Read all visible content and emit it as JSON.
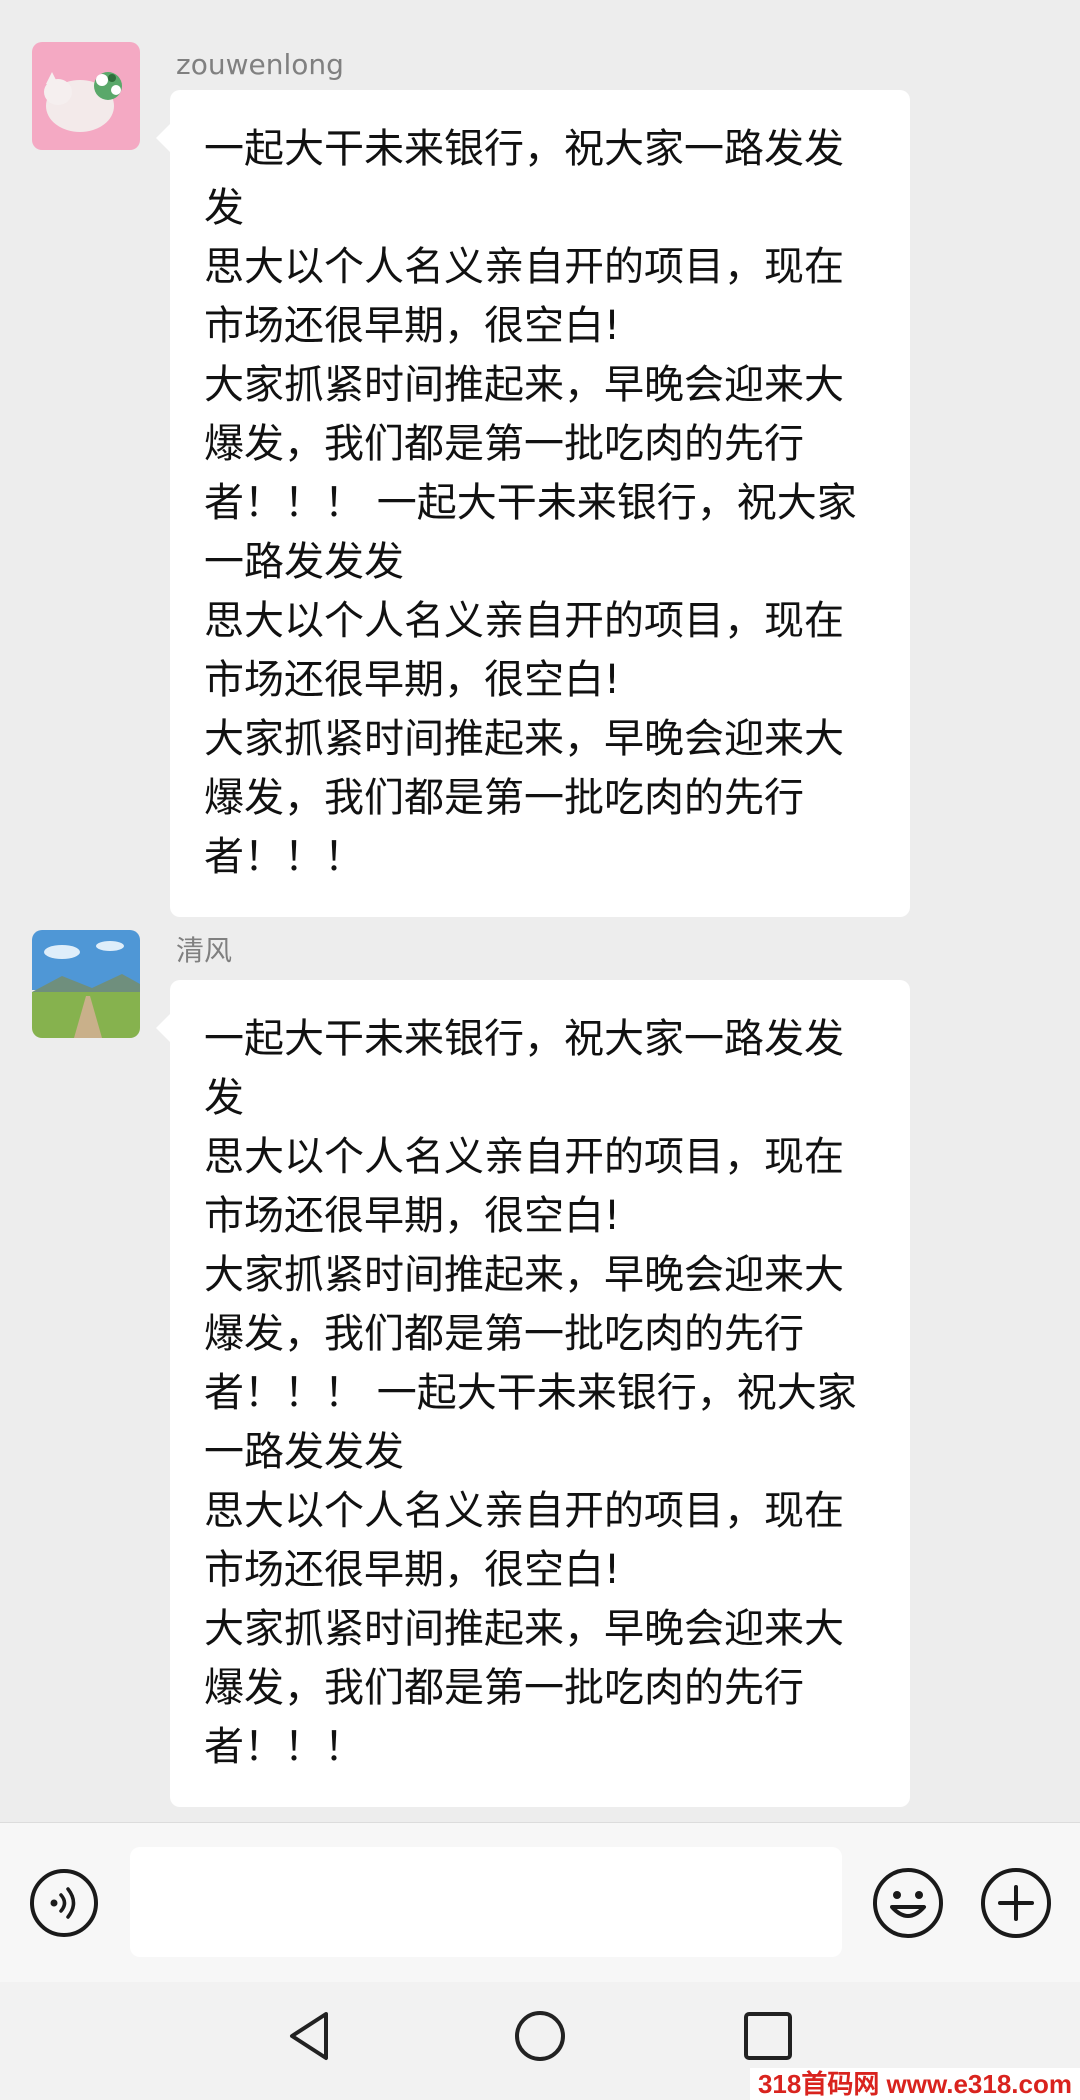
{
  "messages": [
    {
      "sender": "zouwenlong",
      "avatar_icon": "cat-avatar-icon",
      "text": "一起大干未来银行，祝大家一路发发发\n思大以个人名义亲自开的项目，现在市场还很早期，很空白!\n大家抓紧时间推起来，早晚会迎来大爆发，我们都是第一批吃肉的先行者！！！ 一起大干未来银行，祝大家一路发发发\n思大以个人名义亲自开的项目，现在市场还很早期，很空白!\n大家抓紧时间推起来，早晚会迎来大爆发，我们都是第一批吃肉的先行者！！！"
    },
    {
      "sender": "清风",
      "avatar_icon": "landscape-avatar-icon",
      "text": "一起大干未来银行，祝大家一路发发发\n思大以个人名义亲自开的项目，现在市场还很早期，很空白!\n大家抓紧时间推起来，早晚会迎来大爆发，我们都是第一批吃肉的先行者！！！ 一起大干未来银行，祝大家一路发发发\n思大以个人名义亲自开的项目，现在市场还很早期，很空白!\n大家抓紧时间推起来，早晚会迎来大爆发，我们都是第一批吃肉的先行者！！！"
    }
  ],
  "input_bar": {
    "voice_icon": "voice-icon",
    "text_value": "",
    "emoji_icon": "emoji-icon",
    "plus_icon": "plus-icon"
  },
  "nav_bar": {
    "back_icon": "back-icon",
    "home_icon": "home-icon",
    "recent_icon": "recent-apps-icon"
  },
  "watermark": "318首码网 www.e318.com",
  "colors": {
    "background": "#ededed",
    "bubble": "#ffffff",
    "sender_name": "#808080",
    "watermark": "#d9231e"
  }
}
